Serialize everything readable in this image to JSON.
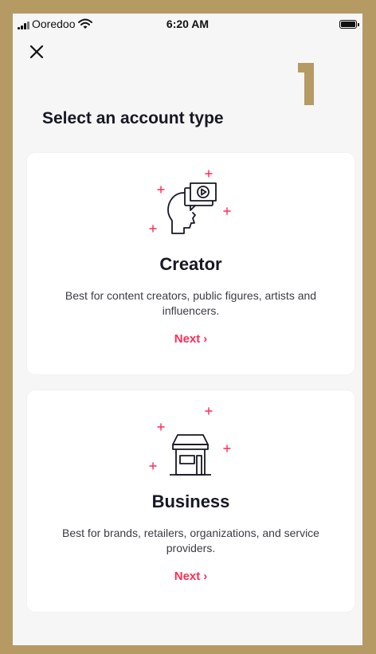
{
  "status_bar": {
    "carrier": "Ooredoo",
    "time": "6:20 AM"
  },
  "step_indicator": "1",
  "page_title": "Select an account type",
  "accent_color": "#fe2c55",
  "cards": [
    {
      "id": "creator",
      "icon": "creator-head-video-icon",
      "title": "Creator",
      "description": "Best for content creators, public figures, artists and influencers.",
      "next_label": "Next",
      "chevron": "›"
    },
    {
      "id": "business",
      "icon": "storefront-icon",
      "title": "Business",
      "description": "Best for brands, retailers, organizations, and service providers.",
      "next_label": "Next",
      "chevron": "›"
    }
  ]
}
